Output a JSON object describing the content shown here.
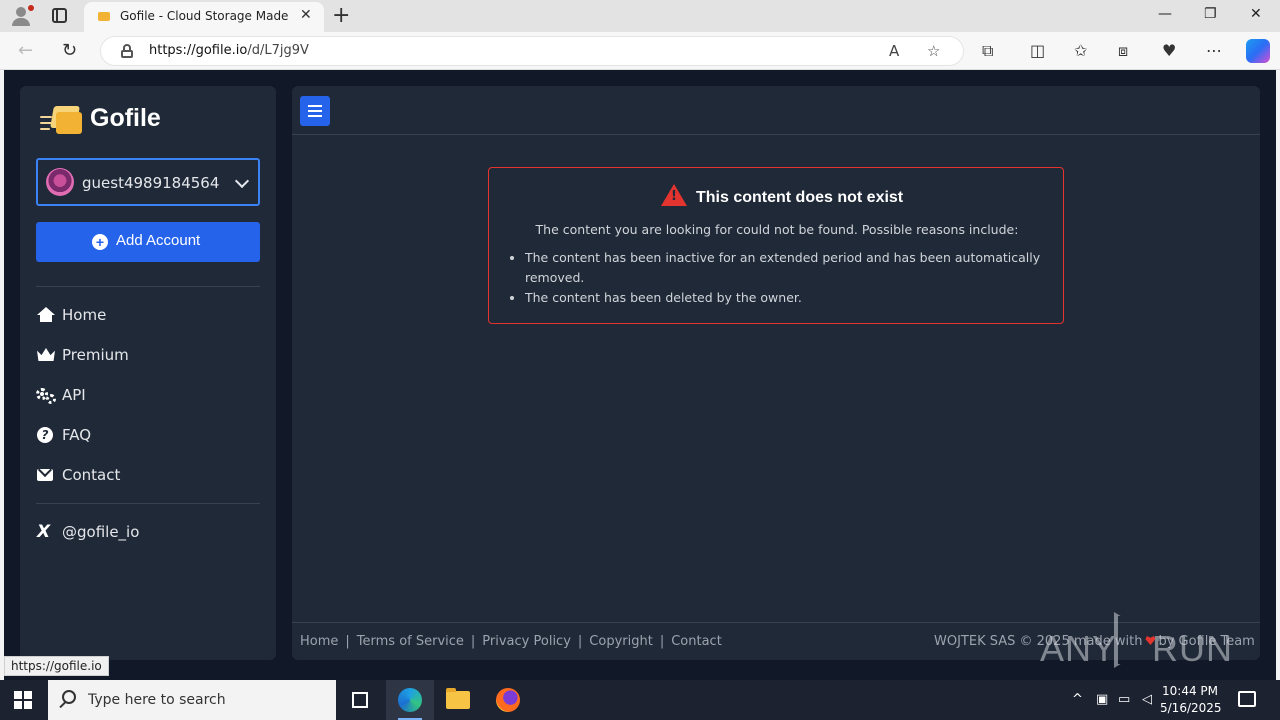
{
  "browser": {
    "tab_title": "Gofile - Cloud Storage Made Sim",
    "tab_close": "✕",
    "new_tab": "+",
    "url_host": "https://gofile.io",
    "url_path": "/d/L7jg9V",
    "window_controls": [
      "—",
      "❐",
      "✕"
    ],
    "status_url": "https://gofile.io"
  },
  "sidebar": {
    "brand": "Gofile",
    "account": "guest4989184564",
    "add_account": "Add Account",
    "add_icon": "+",
    "nav": [
      {
        "label": "Home",
        "icon": "home-icon"
      },
      {
        "label": "Premium",
        "icon": "crown-icon"
      },
      {
        "label": "API",
        "icon": "gears-icon"
      },
      {
        "label": "FAQ",
        "icon": "question-circle-icon"
      },
      {
        "label": "Contact",
        "icon": "envelope-icon"
      }
    ],
    "social": "@gofile_io"
  },
  "alert": {
    "title": "This content does not exist",
    "description": "The content you are looking for could not be found. Possible reasons include:",
    "reasons": [
      "The content has been inactive for an extended period and has been automatically removed.",
      "The content has been deleted by the owner."
    ]
  },
  "footer": {
    "links": [
      "Home",
      "Terms of Service",
      "Privacy Policy",
      "Copyright",
      "Contact"
    ],
    "separator": "|",
    "copyright_prefix": "WOJTEK SAS © 2025 made with",
    "copyright_suffix": "by Gofile Team"
  },
  "watermark": {
    "left": "ANY",
    "right": "RUN"
  },
  "taskbar": {
    "search_placeholder": "Type here to search",
    "time": "10:44 PM",
    "date": "5/16/2025"
  },
  "colors": {
    "accent": "#2563eb",
    "danger": "#e3342f",
    "panel": "#1f2937",
    "background": "#111827"
  }
}
